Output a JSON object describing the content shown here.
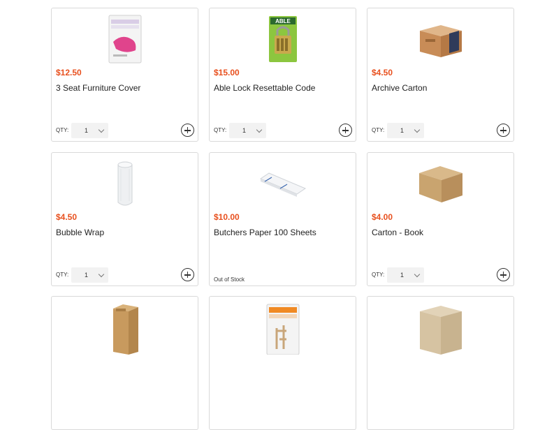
{
  "products": [
    {
      "name": "3 Seat Furniture Cover",
      "price": "$12.50",
      "qty_label": "QTY:",
      "qty": "1",
      "image": "furniture-cover-icon",
      "in_stock": true
    },
    {
      "name": "Able Lock Resettable Code",
      "price": "$15.00",
      "qty_label": "QTY:",
      "qty": "1",
      "image": "padlock-icon",
      "in_stock": true
    },
    {
      "name": "Archive Carton",
      "price": "$4.50",
      "qty_label": "QTY:",
      "qty": "1",
      "image": "archive-carton-icon",
      "in_stock": true
    },
    {
      "name": "Bubble Wrap",
      "price": "$4.50",
      "qty_label": "QTY:",
      "qty": "1",
      "image": "bubble-wrap-icon",
      "in_stock": true
    },
    {
      "name": "Butchers Paper 100 Sheets",
      "price": "$10.00",
      "stock_status": "Out of Stock",
      "image": "butchers-paper-icon",
      "in_stock": false
    },
    {
      "name": "Carton - Book",
      "price": "$4.00",
      "qty_label": "QTY:",
      "qty": "1",
      "image": "book-carton-icon",
      "in_stock": true
    },
    {
      "image": "carton-icon"
    },
    {
      "image": "furniture-protector-icon"
    },
    {
      "image": "carton-icon"
    }
  ],
  "colors": {
    "price": "#e8501e",
    "border": "#d9d9d9",
    "select_bg": "#f2f2f2"
  }
}
